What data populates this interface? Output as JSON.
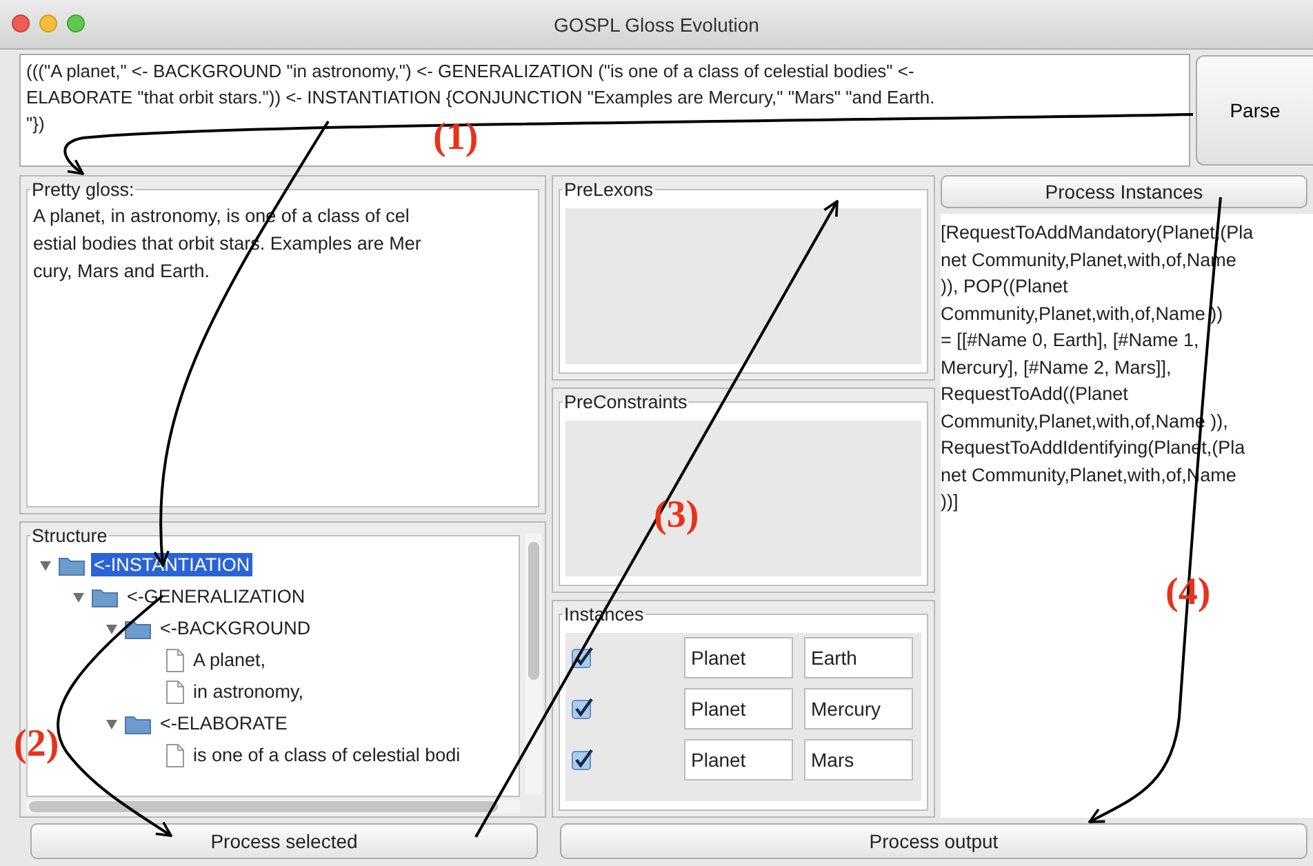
{
  "window": {
    "title": "GOSPL Gloss Evolution"
  },
  "gloss_input": {
    "lines": [
      "(((\"A planet,\" <- BACKGROUND \"in astronomy,\") <- GENERALIZATION (\"is one of a class of celestial bodies\" <-",
      " ELABORATE \"that orbit stars.\")) <- INSTANTIATION {CONJUNCTION \"Examples are Mercury,\" \"Mars\" \"and Earth.",
      "\"})"
    ]
  },
  "parse_button": "Parse",
  "pretty_gloss": {
    "title": "Pretty gloss:",
    "lines": [
      "A planet, in astronomy, is one of a class of cel",
      "estial bodies that orbit stars. Examples are Mer",
      "cury, Mars and Earth."
    ]
  },
  "structure": {
    "title": "Structure",
    "items": [
      {
        "label": "<-INSTANTIATION",
        "expanded": true,
        "selected": true,
        "children": [
          {
            "label": "<-GENERALIZATION",
            "expanded": true,
            "selected": false,
            "children": [
              {
                "label": "<-BACKGROUND",
                "expanded": true,
                "selected": false,
                "children": [
                  {
                    "label": "A planet,",
                    "selected": false
                  },
                  {
                    "label": "in astronomy,",
                    "selected": false
                  }
                ]
              },
              {
                "label": "<-ELABORATE",
                "expanded": true,
                "selected": false,
                "children": [
                  {
                    "label": "is one of a class of celestial bodi",
                    "selected": false
                  }
                ]
              }
            ]
          }
        ]
      }
    ]
  },
  "prelexons": {
    "title": "PreLexons"
  },
  "preconstraints": {
    "title": "PreConstraints"
  },
  "instances": {
    "title": "Instances",
    "rows": [
      {
        "checked": true,
        "type": "Planet",
        "name": "Earth"
      },
      {
        "checked": true,
        "type": "Planet",
        "name": "Mercury"
      },
      {
        "checked": true,
        "type": "Planet",
        "name": "Mars"
      }
    ]
  },
  "process_instances_button": "Process Instances",
  "output": {
    "lines": [
      "[RequestToAddMandatory(Planet,(Pla",
      "net Community,Planet,with,of,Name",
      ")), POP((Planet",
      "Community,Planet,with,of,Name ))",
      "= [[#Name 0, Earth], [#Name 1,",
      "Mercury], [#Name 2, Mars]],",
      "RequestToAdd((Planet",
      "Community,Planet,with,of,Name )),",
      "RequestToAddIdentifying(Planet,(Pla",
      "net Community,Planet,with,of,Name",
      "))]"
    ]
  },
  "process_selected_button": "Process selected",
  "process_output_button": "Process output",
  "annotations": [
    {
      "label": "(1)"
    },
    {
      "label": "(2)"
    },
    {
      "label": "(3)"
    },
    {
      "label": "(4)"
    }
  ]
}
